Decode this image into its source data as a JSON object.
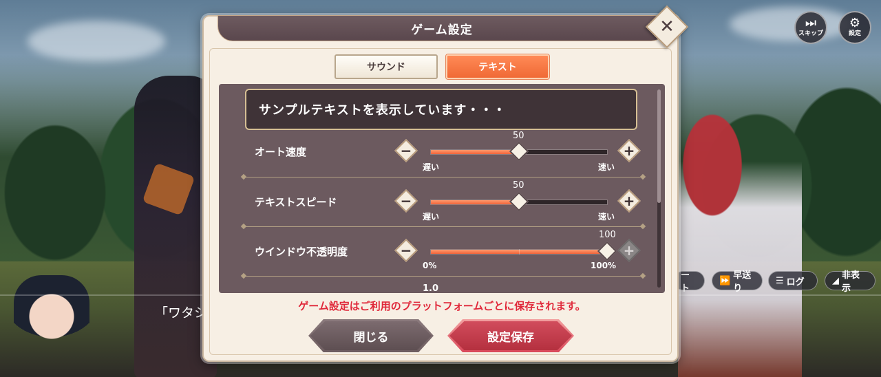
{
  "dialog": {
    "title": "ゲーム設定",
    "close_symbol": "✕"
  },
  "tabs": [
    {
      "label": "サウンド",
      "active": false
    },
    {
      "label": "テキスト",
      "active": true
    }
  ],
  "sample_text": "サンプルテキストを表示しています・・・",
  "settings": [
    {
      "label": "オート速度",
      "value": "50",
      "value_fraction": 0.5,
      "min_label": "遅い",
      "max_label": "速い",
      "minus": "−",
      "plus": "+"
    },
    {
      "label": "テキストスピード",
      "value": "50",
      "value_fraction": 0.5,
      "min_label": "遅い",
      "max_label": "速い",
      "minus": "−",
      "plus": "+"
    },
    {
      "label": "ウインドウ不透明度",
      "value": "100",
      "value_fraction": 1.0,
      "min_label": "0%",
      "max_label": "100%",
      "minus": "−",
      "plus": "+"
    }
  ],
  "next_row_value": "1.0",
  "notice": "ゲーム設定はご利用のプラットフォームごとに保存されます。",
  "buttons": {
    "close": "閉じる",
    "save": "設定保存"
  },
  "hud": {
    "skip": "スキップ",
    "settings": "設定"
  },
  "adv_bar": {
    "auto": "ート",
    "fast": "早送り",
    "log": "ログ",
    "hide": "非表示"
  },
  "adv_text": "「ワタシ",
  "colors": {
    "accent_orange": "#f06a36",
    "save_red": "#c03646",
    "notice_red": "#e0283a",
    "panel": "#6c5a5f"
  }
}
